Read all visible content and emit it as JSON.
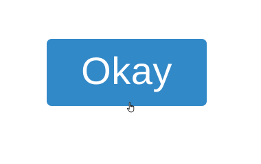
{
  "dialog": {
    "button_label": "Okay"
  },
  "colors": {
    "background": "#ffffff",
    "button_fill": "#3289c8",
    "button_text": "#ffffff"
  },
  "icons": {
    "cursor": "hand-pointer-icon"
  }
}
